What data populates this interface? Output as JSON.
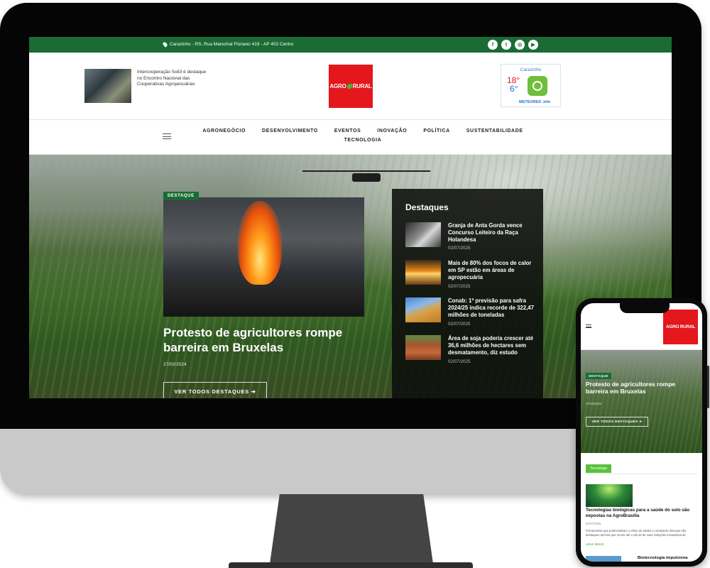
{
  "topbar": {
    "address": "Carazinho - RS, Rua Marechal Floriano 419 - AP 402 Centro",
    "socials": [
      {
        "icon": "facebook-icon",
        "glyph": "f"
      },
      {
        "icon": "twitter-icon",
        "glyph": "t"
      },
      {
        "icon": "instagram-icon",
        "glyph": "◎"
      },
      {
        "icon": "youtube-icon",
        "glyph": "▶"
      }
    ]
  },
  "header": {
    "news_text": "Intercooperação Soli3 é destaque no Encontro Nacional das Cooperativas Agropecuárias",
    "logo_left": "AGRO",
    "logo_right": "RURAL",
    "weather": {
      "city": "Carazinho",
      "high": "18°",
      "low": "6°",
      "brand": "METEORED .info"
    }
  },
  "nav": {
    "items": [
      "AGRONEGÓCIO",
      "DESENVOLVIMENTO",
      "EVENTOS",
      "INOVAÇÃO",
      "POLÍTICA",
      "SUSTENTABILIDADE",
      "TECNOLOGIA"
    ]
  },
  "featured": {
    "tag": "DESTAQUE",
    "title": "Protesto de agricultores rompe barreira em Bruxelas",
    "date": "27/02/2024",
    "button": "VER TODOS DESTAQUES ➔"
  },
  "destaques": {
    "title": "Destaques",
    "items": [
      {
        "title": "Granja de Anta Gorda vence Concurso Leiteiro da Raça Holandesa",
        "date": "02/07/2025"
      },
      {
        "title": "Mais de 80% dos focos de calor em SP estão em áreas de agropecuária",
        "date": "02/07/2025"
      },
      {
        "title": "Conab: 1ª previsão para safra 2024/25 indica recorde de 322,47 milhões de toneladas",
        "date": "02/07/2025"
      },
      {
        "title": "Área de soja poderia crescer até 36,6 milhões de hectares sem desmatamento, diz estudo",
        "date": "02/07/2025"
      }
    ]
  },
  "phone": {
    "logo": "AGRO RURAL",
    "tag": "DESTAQUE",
    "title": "Protesto de agricultores rompe barreira em Bruxelas",
    "date": "27/02/2024",
    "button": "VER TODOS DESTAQUES ➔",
    "section": "Tecnologia",
    "article": {
      "title": "Tecnologias biológicas para a saúde do solo são expostas na AgroBrasília",
      "date": "02/07/2025",
      "excerpt": "Ferramentas que potencializam o efeito do adubo e combatem doenças são destaques da feira que ocorre até o dia 25 de maio Soluções inovadoras do",
      "more": "LEIA MAIS"
    },
    "next_title": "Biotecnologia impulsiona"
  }
}
